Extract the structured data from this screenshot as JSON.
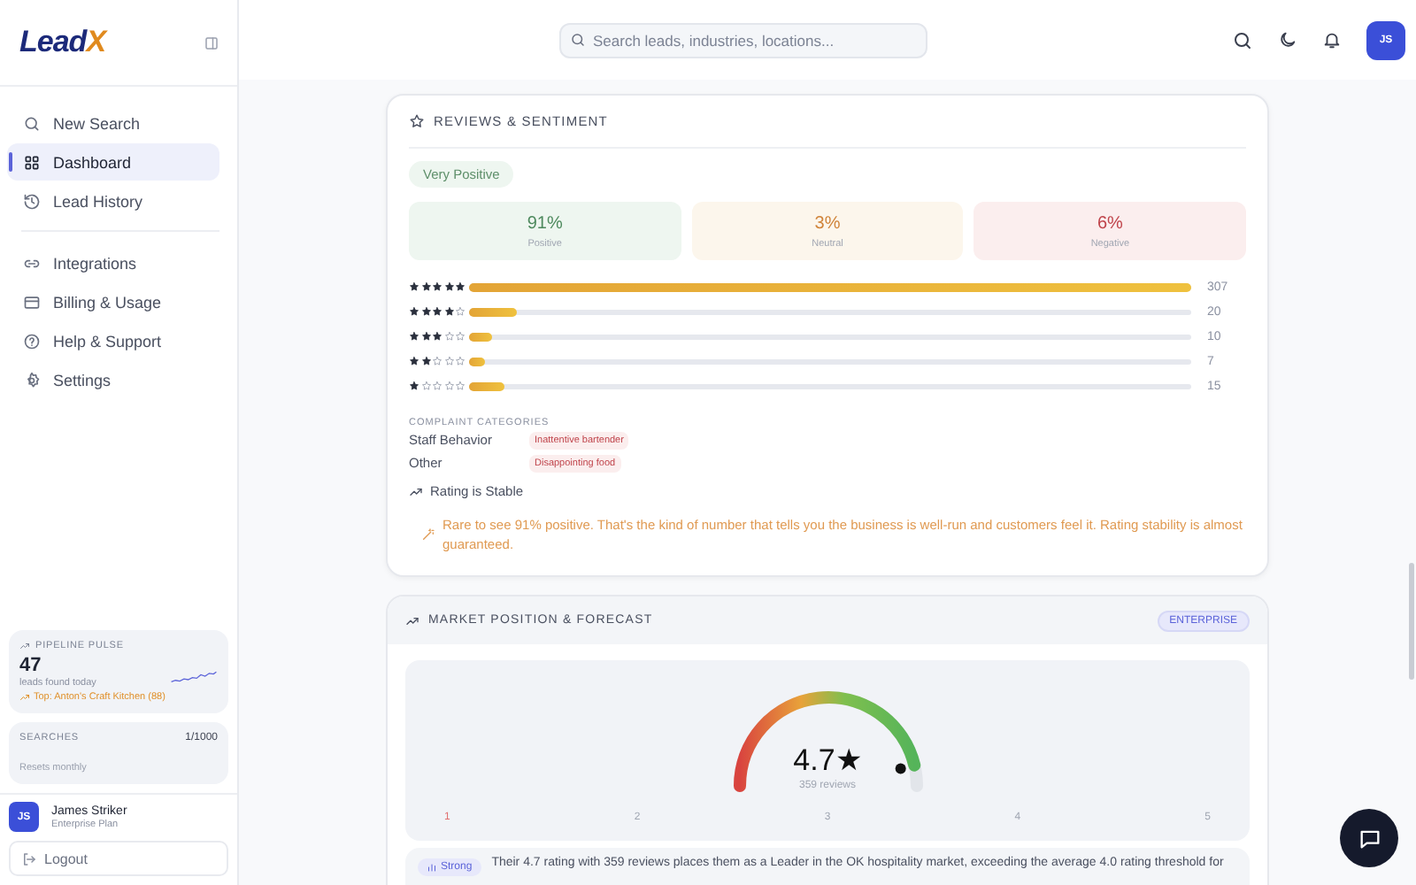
{
  "sidebar": {
    "logo": {
      "word": "Lead",
      "accent": "X"
    },
    "nav_groups": [
      [
        {
          "label": "New Search",
          "selected": false
        },
        {
          "label": "Dashboard",
          "selected": true
        },
        {
          "label": "Lead History",
          "selected": false
        }
      ],
      [
        {
          "label": "Integrations",
          "selected": false
        },
        {
          "label": "Billing & Usage",
          "selected": false
        },
        {
          "label": "Help & Support",
          "selected": false
        },
        {
          "label": "Settings",
          "selected": false
        }
      ]
    ],
    "pipeline": {
      "title": "PIPELINE PULSE",
      "count": "47",
      "caption": "leads found today",
      "top": "Top: Anton's Craft Kitchen (88)"
    },
    "searches": {
      "label": "SEARCHES",
      "count": "1/1000",
      "note": "Resets monthly"
    },
    "user": {
      "initials": "JS",
      "name": "James Striker",
      "plan": "Enterprise Plan"
    },
    "logout": "Logout"
  },
  "header": {
    "search": {
      "placeholder": "Search leads, industries, locations..."
    },
    "avatar": "JS"
  },
  "reviews": {
    "title": "REVIEWS & SENTIMENT",
    "badge": "Very Positive",
    "sentiment": [
      {
        "kind": "positive",
        "value": "91%",
        "label": "Positive"
      },
      {
        "kind": "neutral",
        "value": "3%",
        "label": "Neutral"
      },
      {
        "kind": "negative",
        "value": "6%",
        "label": "Negative"
      }
    ],
    "distribution": [
      {
        "stars": 5,
        "level": 1,
        "count": "307"
      },
      {
        "stars": 4,
        "level": 0.065,
        "count": "20"
      },
      {
        "stars": 3,
        "level": 0.033,
        "count": "10"
      },
      {
        "stars": 2,
        "level": 0.023,
        "count": "7"
      },
      {
        "stars": 1,
        "level": 0.049,
        "count": "15"
      }
    ],
    "complaints": {
      "title": "COMPLAINT CATEGORIES",
      "items": [
        {
          "category": "Staff Behavior",
          "tag": "Inattentive bartender"
        },
        {
          "category": "Other",
          "tag": "Disappointing food"
        }
      ]
    },
    "trend": "Rating is Stable",
    "insight": "Rare to see 91% positive. That's the kind of number that tells you the business is well-run and customers feel it. Rating stability is almost guaranteed."
  },
  "market": {
    "title": "MARKET POSITION & FORECAST",
    "badge": "ENTERPRISE",
    "gauge": {
      "rating": "4.7★",
      "reviews": "359 reviews",
      "level": 0.925,
      "scale": [
        "1",
        "2",
        "3",
        "4",
        "5"
      ]
    },
    "summary": {
      "badge": "Strong",
      "text": "Their 4.7 rating with 359 reviews places them as a Leader in the OK hospitality market, exceeding the average 4.0 rating threshold for"
    }
  }
}
